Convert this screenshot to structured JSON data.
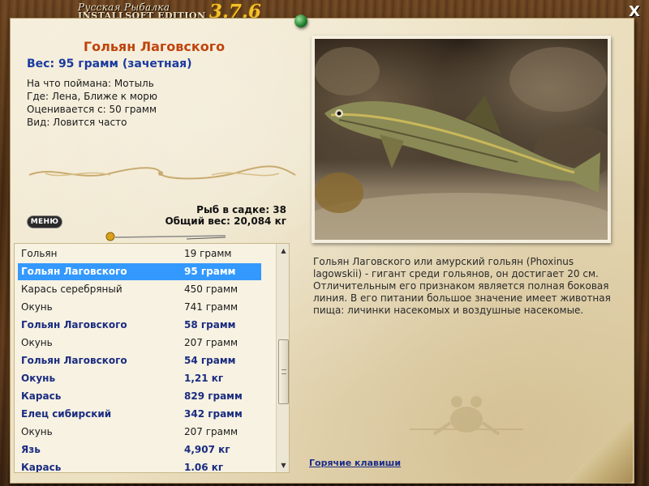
{
  "app": {
    "brand_top": "Русская Рыбалка",
    "brand_bottom": "INSTALLSOFT EDITION",
    "version": "3.7.6",
    "close_label": "X"
  },
  "catch": {
    "name": "Гольян Лаговского",
    "weight_line": "Вес: 95 грамм (зачетная)",
    "bait": "На что поймана: Мотыль",
    "place": "Где: Лена, Ближе к морю",
    "valued_from": "Оценивается с: 50 грамм",
    "kind": "Вид: Ловится часто"
  },
  "stats": {
    "count_line": "Рыб в садке: 38",
    "total_line": "Общий вес: 20,084 кг"
  },
  "menu_label": "МЕНЮ",
  "fish_list": [
    {
      "name": "Гольян",
      "weight": "19 грамм",
      "style": "normal"
    },
    {
      "name": "Гольян Лаговского",
      "weight": "95 грамм",
      "style": "selected"
    },
    {
      "name": "Карась серебряный",
      "weight": "450 грамм",
      "style": "normal"
    },
    {
      "name": "Окунь",
      "weight": "741 грамм",
      "style": "normal"
    },
    {
      "name": "Гольян Лаговского",
      "weight": "58 грамм",
      "style": "highlight"
    },
    {
      "name": "Окунь",
      "weight": "207 грамм",
      "style": "normal"
    },
    {
      "name": "Гольян Лаговского",
      "weight": "54 грамм",
      "style": "highlight"
    },
    {
      "name": "Окунь",
      "weight": "1,21 кг",
      "style": "highlight"
    },
    {
      "name": "Карась",
      "weight": "829 грамм",
      "style": "highlight"
    },
    {
      "name": "Елец сибирский",
      "weight": "342 грамм",
      "style": "highlight"
    },
    {
      "name": "Окунь",
      "weight": "207 грамм",
      "style": "normal"
    },
    {
      "name": "Язь",
      "weight": "4,907 кг",
      "style": "highlight"
    },
    {
      "name": "Карась",
      "weight": "1.06 кг",
      "style": "highlight"
    }
  ],
  "description": "Гольян Лаговского или амурский гольян (Phoxinus lagowskii) - гигант среди гольянов, он достигает 20 см. Отличительным его признаком является полная боковая линия. В его питании большое значение имеет животная пища: личинки насекомых и воздушные насекомые.",
  "hotkeys_label": "Горячие клавиши",
  "icons": {
    "close": "close-icon",
    "pin": "pin-icon",
    "scroll_up": "chevron-up-icon",
    "scroll_down": "chevron-down-icon"
  },
  "colors": {
    "title": "#c0440c",
    "weight": "#1a3aa0",
    "selection": "#3399ff",
    "highlight": "#1a2c80",
    "version": "#f2c230"
  }
}
